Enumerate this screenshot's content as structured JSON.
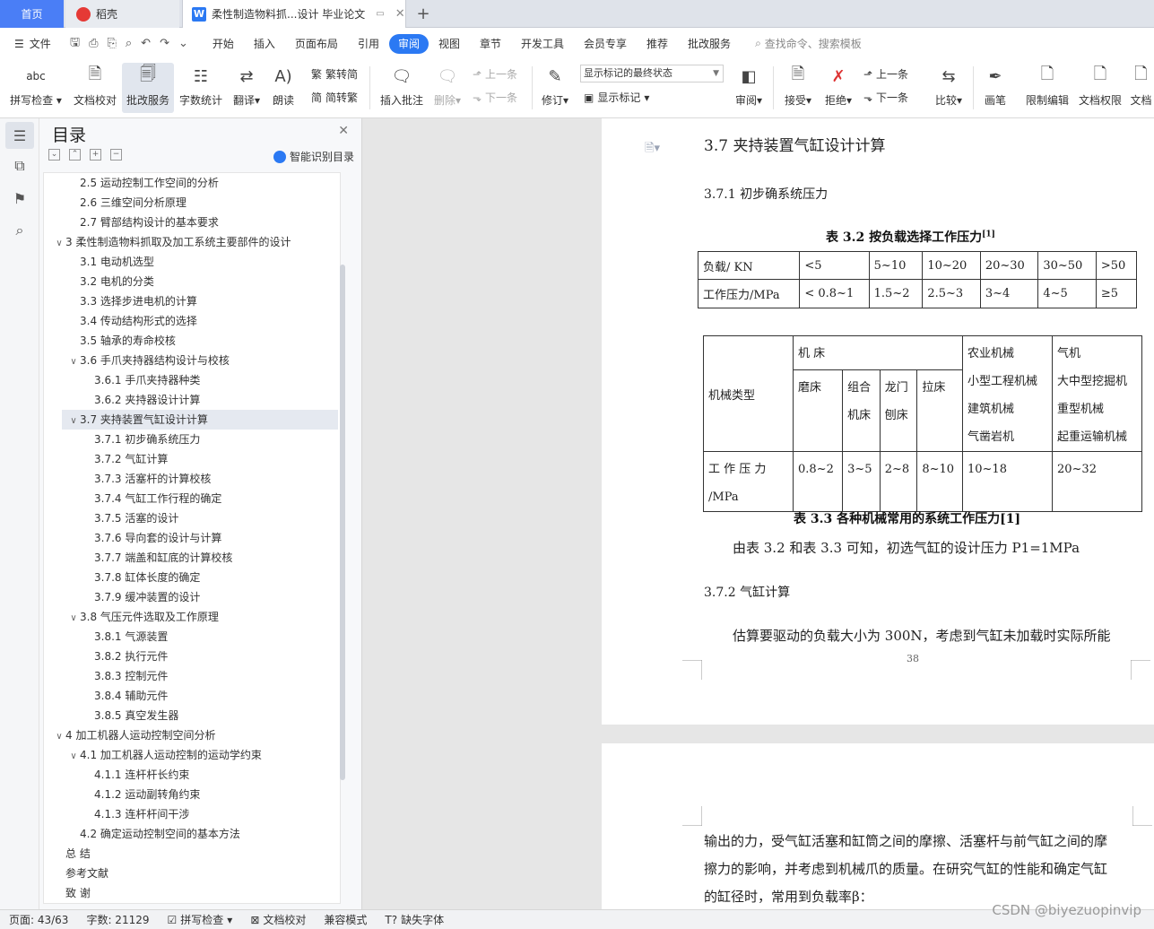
{
  "tabs": {
    "home": "首页",
    "daoke": "稻壳",
    "doc": "柔性制造物料抓...设计 毕业论文"
  },
  "menubar": {
    "file": "文件",
    "items": [
      "开始",
      "插入",
      "页面布局",
      "引用",
      "审阅",
      "视图",
      "章节",
      "开发工具",
      "会员专享",
      "推荐",
      "批改服务"
    ],
    "active": "审阅",
    "search": "查找命令、搜索模板"
  },
  "ribbon": {
    "spellcheck": "拼写检查",
    "doccheck": "文档校对",
    "review_service": "批改服务",
    "wordcount": "字数统计",
    "translate": "翻译",
    "read": "朗读",
    "trad": "繁转简",
    "simp": "简转繁",
    "insert_comment": "插入批注",
    "delete": "删除",
    "prev": "上一条",
    "next": "下一条",
    "revise": "修订",
    "markup_state": "显示标记的最终状态",
    "show_markup": "显示标记",
    "review": "审阅",
    "accept": "接受",
    "reject": "拒绝",
    "prev2": "上一条",
    "next2": "下一条",
    "compare": "比较",
    "pen": "画笔",
    "restrict": "限制编辑",
    "doc_perm": "文档权限",
    "doc_more": "文档"
  },
  "toc": {
    "title": "目录",
    "smart": "智能识别目录",
    "items": [
      {
        "text": "2.5  运动控制工作空间的分析",
        "level": 2,
        "caret": ""
      },
      {
        "text": "2.6 三维空间分析原理",
        "level": 2,
        "caret": ""
      },
      {
        "text": "2.7 臂部结构设计的基本要求",
        "level": 2,
        "caret": ""
      },
      {
        "text": "3  柔性制造物料抓取及加工系统主要部件的设计",
        "level": 1,
        "caret": "v"
      },
      {
        "text": "3.1 电动机选型",
        "level": 2,
        "caret": ""
      },
      {
        "text": "3.2 电机的分类",
        "level": 2,
        "caret": ""
      },
      {
        "text": "3.3 选择步进电机的计算",
        "level": 2,
        "caret": ""
      },
      {
        "text": "3.4 传动结构形式的选择",
        "level": 2,
        "caret": ""
      },
      {
        "text": "3.5  轴承的寿命校核",
        "level": 2,
        "caret": ""
      },
      {
        "text": "3.6  手爪夹持器结构设计与校核",
        "level": 2,
        "caret": "v"
      },
      {
        "text": "3.6.1 手爪夹持器种类",
        "level": 3,
        "caret": ""
      },
      {
        "text": "3.6.2 夹持器设计计算",
        "level": 3,
        "caret": ""
      },
      {
        "text": "3.7  夹持装置气缸设计计算",
        "level": 2,
        "caret": "v",
        "selected": true
      },
      {
        "text": "3.7.1  初步确系统压力",
        "level": 3,
        "caret": ""
      },
      {
        "text": "3.7.2 气缸计算",
        "level": 3,
        "caret": ""
      },
      {
        "text": "3.7.3  活塞杆的计算校核",
        "level": 3,
        "caret": ""
      },
      {
        "text": "3.7.4  气缸工作行程的确定",
        "level": 3,
        "caret": ""
      },
      {
        "text": "3.7.5  活塞的设计",
        "level": 3,
        "caret": ""
      },
      {
        "text": "3.7.6  导向套的设计与计算",
        "level": 3,
        "caret": ""
      },
      {
        "text": "3.7.7  端盖和缸底的计算校核",
        "level": 3,
        "caret": ""
      },
      {
        "text": "3.7.8  缸体长度的确定",
        "level": 3,
        "caret": ""
      },
      {
        "text": "3.7.9  缓冲装置的设计",
        "level": 3,
        "caret": ""
      },
      {
        "text": "3.8  气压元件选取及工作原理",
        "level": 2,
        "caret": "v"
      },
      {
        "text": "3.8.1  气源装置",
        "level": 3,
        "caret": ""
      },
      {
        "text": "3.8.2  执行元件",
        "level": 3,
        "caret": ""
      },
      {
        "text": "3.8.3  控制元件",
        "level": 3,
        "caret": ""
      },
      {
        "text": "3.8.4  辅助元件",
        "level": 3,
        "caret": ""
      },
      {
        "text": "3.8.5  真空发生器",
        "level": 3,
        "caret": ""
      },
      {
        "text": "4  加工机器人运动控制空间分析",
        "level": 1,
        "caret": "v"
      },
      {
        "text": "4.1 加工机器人运动控制的运动学约束",
        "level": 2,
        "caret": "v"
      },
      {
        "text": "4.1.1  连杆杆长约束",
        "level": 3,
        "caret": ""
      },
      {
        "text": "4.1.2  运动副转角约束",
        "level": 3,
        "caret": ""
      },
      {
        "text": "4.1.3  连杆杆间干涉",
        "level": 3,
        "caret": ""
      },
      {
        "text": "4.2  确定运动控制空间的基本方法",
        "level": 2,
        "caret": ""
      },
      {
        "text": "总   结",
        "level": 1,
        "caret": ""
      },
      {
        "text": "参考文献",
        "level": 1,
        "caret": ""
      },
      {
        "text": "致   谢",
        "level": 1,
        "caret": ""
      }
    ]
  },
  "document": {
    "section_title": "3.7  夹持装置气缸设计计算",
    "subsection1": "3.7.1  初步确系统压力",
    "table1_caption": "表 3.2  按负载选择工作压力",
    "table1_sup": "[1]",
    "table1": {
      "row1": [
        "负载/ KN",
        "<5",
        "5~10",
        "10~20",
        "20~30",
        "30~50",
        ">50"
      ],
      "row2": [
        "工作压力/MPa",
        "< 0.8~1",
        "1.5~2",
        "2.5~3",
        "3~4",
        "4~5",
        "≥5"
      ]
    },
    "table2": {
      "mech_type": "机械类型",
      "machine_tool": "机  床",
      "grinder": "磨床",
      "combo": "组合",
      "combo2": "机床",
      "gantry": "龙门",
      "gantry2": "刨床",
      "broach": "拉床",
      "agri": [
        "农业机械",
        "小型工程机械",
        "建筑机械",
        "气凿岩机"
      ],
      "heavy": [
        "气机",
        "大中型挖掘机",
        "重型机械",
        "起重运输机械"
      ],
      "pressure_label": "工  作  压  力",
      "pressure_unit": "/MPa",
      "values": [
        "0.8~2",
        "3~5",
        "2~8",
        "8~10",
        "10~18",
        "20~32"
      ]
    },
    "table2_caption": "表 3.3  各种机械常用的系统工作压力[1]",
    "para1": "由表 3.2 和表 3.3 可知，初选气缸的设计压力 P1=1MPa",
    "subsection2": "3.7.2 气缸计算",
    "para2": "估算要驱动的负载大小为 300N，考虑到气缸未加载时实际所能",
    "page_number": "38",
    "page2_lines": [
      "输出的力，受气缸活塞和缸筒之间的摩擦、活塞杆与前气缸之间的摩",
      "擦力的影响，并考虑到机械爪的质量。在研究气缸的性能和确定气缸",
      "的缸径时，常用到负载率β："
    ]
  },
  "statusbar": {
    "page": "页面: 43/63",
    "words": "字数: 21129",
    "spell": "拼写检查",
    "doccheck": "文档校对",
    "compat": "兼容模式",
    "missing_font": "缺失字体"
  },
  "watermark": "CSDN @biyezuopinvip",
  "colors": {
    "accent": "#2b79f3",
    "tab_home": "#4a7ef6",
    "daoke_red": "#e53935"
  }
}
